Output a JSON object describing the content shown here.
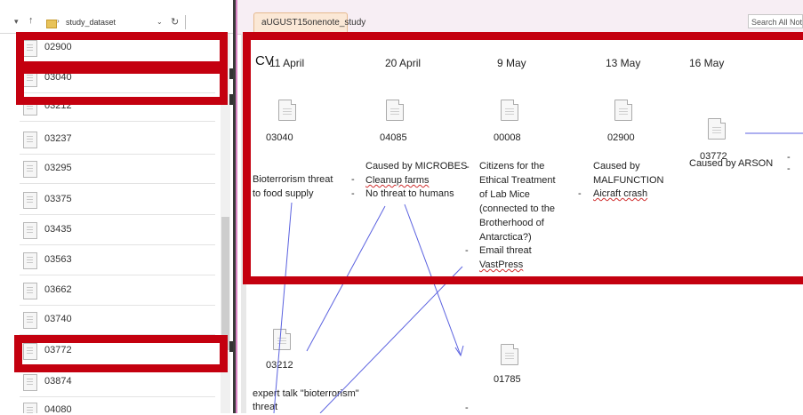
{
  "explorer": {
    "path_segment": "study_dataset",
    "files": [
      "02900",
      "03040",
      "03212",
      "03237",
      "03295",
      "03375",
      "03435",
      "03563",
      "03662",
      "03740",
      "03772",
      "03874",
      "04080"
    ]
  },
  "onenote": {
    "tab_title": "aUGUST15onenote_study",
    "search_placeholder": "Search All Notebooks",
    "cv_label": "CV",
    "timeline": [
      {
        "date": "11 April",
        "file": "03040",
        "lines": [
          "Bioterrorism threat",
          "to food supply"
        ]
      },
      {
        "date": "20 April",
        "file": "04085",
        "lines": [
          "Caused by MICROBES",
          "Cleanup farms",
          "No threat to humans"
        ]
      },
      {
        "date": "9 May",
        "file": "00008",
        "lines": [
          "Citizens for the",
          "Ethical Treatment",
          "of Lab Mice",
          "(connected to the",
          "Brotherhood of",
          "Antarctica?)",
          "Email threat",
          "VastPress"
        ]
      },
      {
        "date": "13 May",
        "file": "02900",
        "lines": [
          "Caused by",
          "MALFUNCTION",
          "Aicraft crash"
        ]
      },
      {
        "date": "16 May",
        "file": "03772",
        "lines": [
          "Caused by ARSON"
        ]
      }
    ],
    "lower": {
      "file_a": "03212",
      "file_b": "01785",
      "lines": [
        "expert talk \"bioterrorism\"",
        "threat"
      ]
    },
    "bullet": "-"
  }
}
